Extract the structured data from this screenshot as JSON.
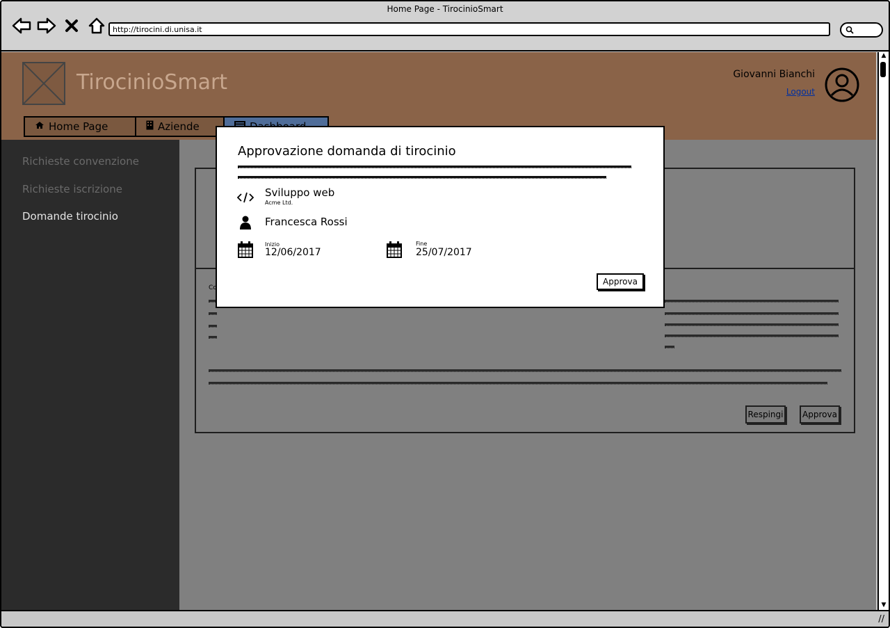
{
  "browser": {
    "window_title": "Home Page - TirocinioSmart",
    "url": "http://tirocini.di.unisa.it"
  },
  "header": {
    "app_title": "TirocinioSmart",
    "user_name": "Giovanni Bianchi",
    "logout_label": "Logout"
  },
  "tabs": [
    {
      "label": "Home Page",
      "icon": "home-icon"
    },
    {
      "label": "Aziende",
      "icon": "building-icon"
    },
    {
      "label": "Dashboard",
      "icon": "dashboard-icon"
    }
  ],
  "sidebar": {
    "items": [
      {
        "label": "Richieste convenzione"
      },
      {
        "label": "Richieste iscrizione"
      },
      {
        "label": "Domande tirocinio"
      }
    ]
  },
  "panel": {
    "body_label_fragment": "Co",
    "reject_label": "Respingi",
    "approve_label": "Approva"
  },
  "modal": {
    "title": "Approvazione domanda di tirocinio",
    "project_name": "Sviluppo web",
    "company": "Acme Ltd.",
    "student": "Francesca Rossi",
    "start_label": "Inizio",
    "start_date": "12/06/2017",
    "end_label": "Fine",
    "end_date": "25/07/2017",
    "approve_label": "Approva"
  },
  "colors": {
    "header_bg": "#8a6348",
    "sidebar_bg": "#2b2b2b",
    "active_tab": "#4f6d99",
    "content_bg": "#808080"
  }
}
